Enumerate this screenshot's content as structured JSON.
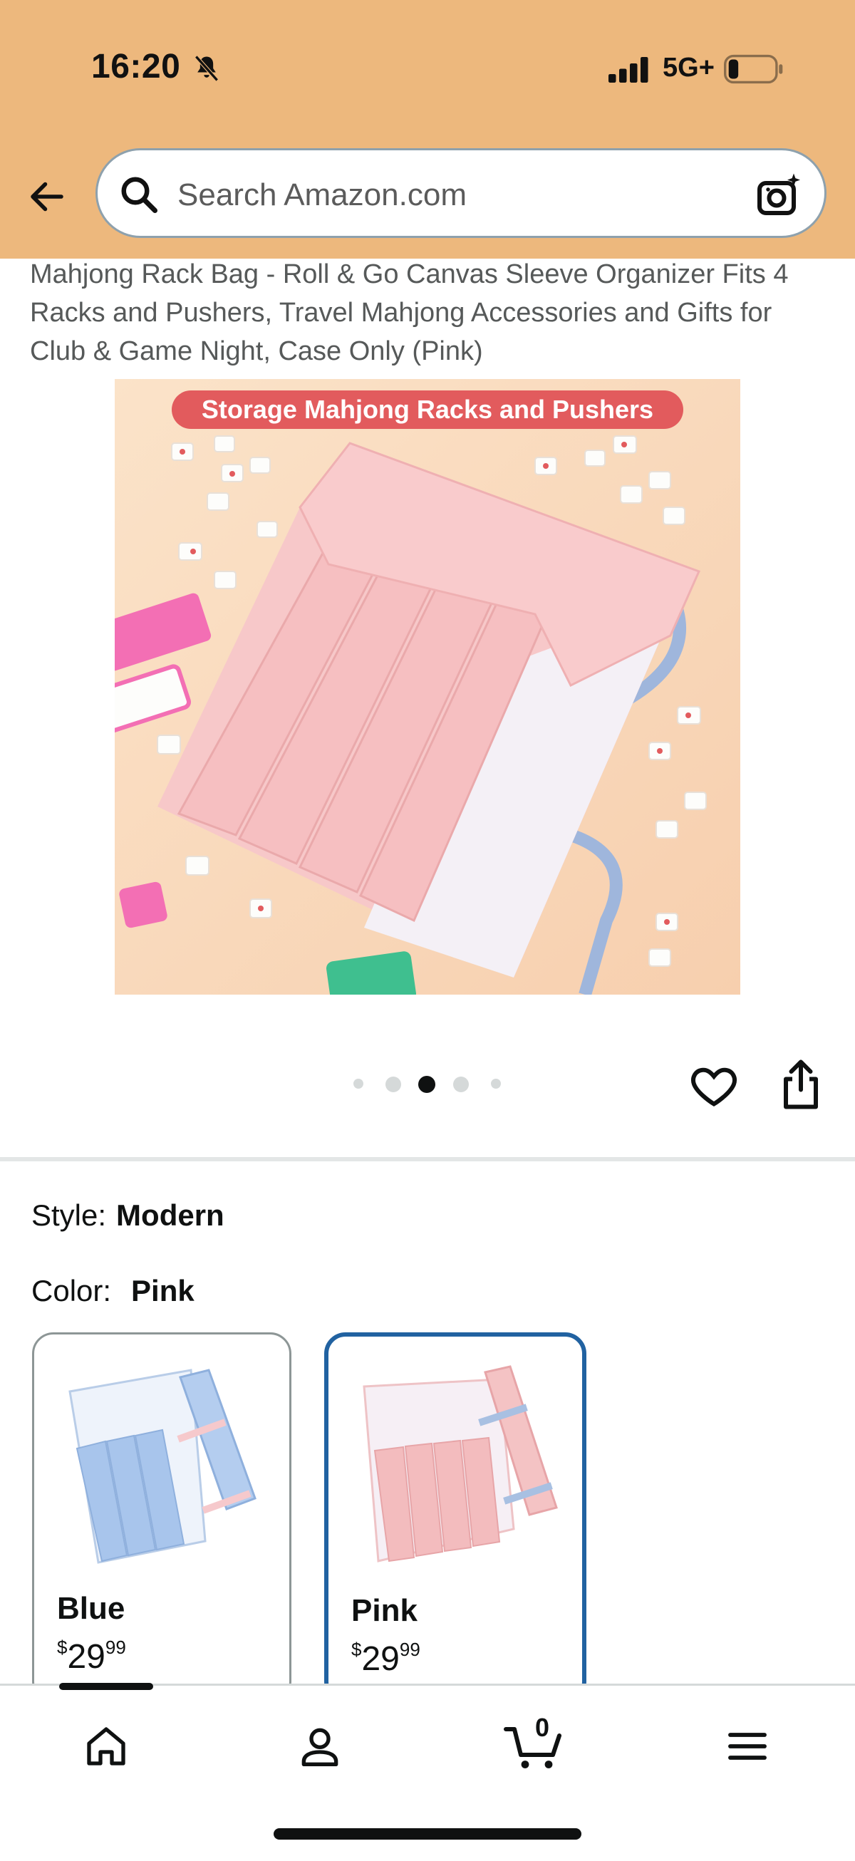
{
  "status_bar": {
    "time": "16:20",
    "network": "5G+"
  },
  "header": {
    "search_placeholder": "Search Amazon.com",
    "background_color": "#EDB87D"
  },
  "product": {
    "title": "Mahjong Rack Bag - Roll & Go Canvas Sleeve Organizer Fits 4 Racks and Pushers, Travel Mahjong Accessories and Gifts for Club & Game Night, Case Only (Pink)",
    "image_banner": "Storage Mahjong Racks and Pushers",
    "carousel": {
      "total": 5,
      "active_index": 3
    }
  },
  "variations": {
    "style_label": "Style:",
    "style_value": "Modern",
    "color_label": "Color:",
    "color_value": "Pink",
    "swatches": [
      {
        "name": "Blue",
        "price_symbol": "$",
        "price_whole": "29",
        "price_fraction": "99",
        "selected": false
      },
      {
        "name": "Pink",
        "price_symbol": "$",
        "price_whole": "29",
        "price_fraction": "99",
        "selected": true
      }
    ]
  },
  "bottom_nav": {
    "items": [
      "home-icon",
      "account-icon",
      "cart-icon",
      "menu-icon"
    ],
    "cart_count": "0"
  },
  "colors": {
    "selected_border": "#2162a1",
    "header": "#EDB87D",
    "banner": "#e25b5d"
  }
}
